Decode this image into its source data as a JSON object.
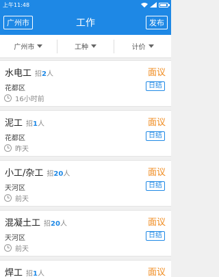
{
  "status_bar": {
    "time": "上午11:48"
  },
  "header": {
    "city": "广州市",
    "title": "工作",
    "publish": "发布"
  },
  "filters": [
    {
      "label": "广州市"
    },
    {
      "label": "工种"
    },
    {
      "label": "计价"
    }
  ],
  "jobs": [
    {
      "title": "水电工",
      "hiring_prefix": "招",
      "count": "2",
      "unit": "人",
      "salary": "面议",
      "district": "花都区",
      "pay_type": "日结",
      "time": "16小时前"
    },
    {
      "title": "泥工",
      "hiring_prefix": "招",
      "count": "1",
      "unit": "人",
      "salary": "面议",
      "district": "花都区",
      "pay_type": "日结",
      "time": "昨天"
    },
    {
      "title": "小工/杂工",
      "hiring_prefix": "招",
      "count": "20",
      "unit": "人",
      "salary": "面议",
      "district": "天河区",
      "pay_type": "日结",
      "time": "前天"
    },
    {
      "title": "混凝土工",
      "hiring_prefix": "招",
      "count": "20",
      "unit": "人",
      "salary": "面议",
      "district": "天河区",
      "pay_type": "日结",
      "time": "前天"
    },
    {
      "title": "焊工",
      "hiring_prefix": "招",
      "count": "1",
      "unit": "人",
      "salary": "面议",
      "district": "",
      "pay_type": "",
      "time": ""
    }
  ],
  "colors": {
    "brand": "#1e88e5",
    "salary": "#f08a1c"
  }
}
